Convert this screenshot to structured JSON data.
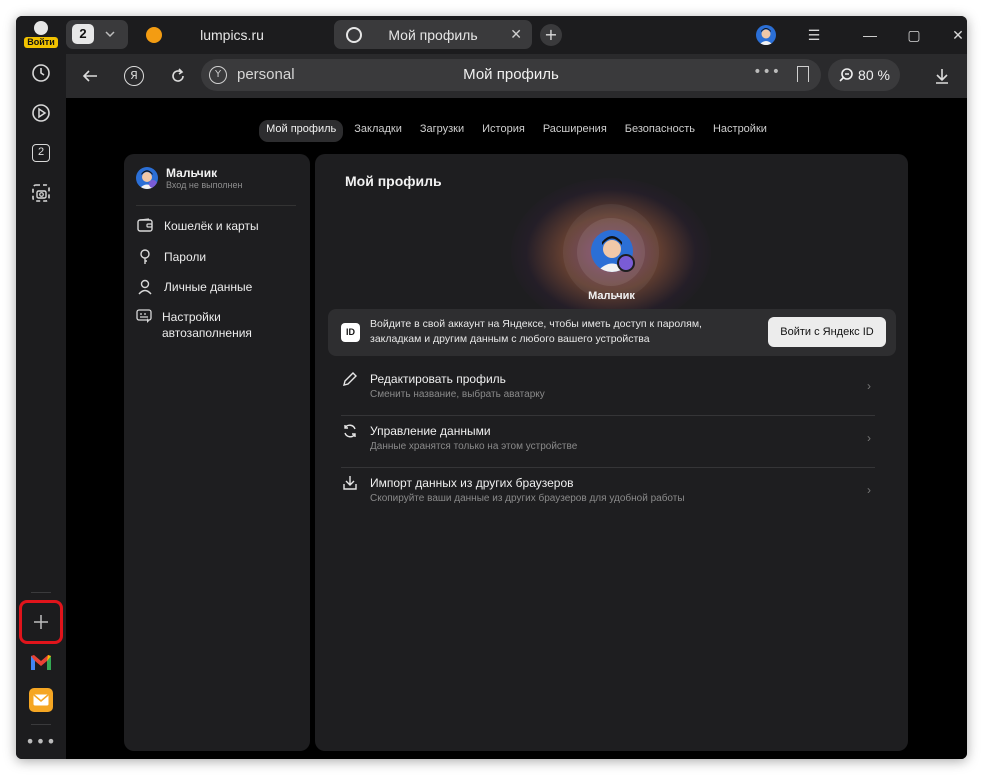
{
  "rail": {
    "signin_label": "Войти",
    "tab_count": "2"
  },
  "tabs": {
    "count": "2",
    "items": [
      {
        "title": "lumpics.ru",
        "active": false
      },
      {
        "title": "Мой профиль",
        "active": true
      }
    ]
  },
  "address": {
    "host": "personal",
    "page_title": "Мой профиль",
    "zoom": "80 %"
  },
  "settings_nav": [
    "Мой профиль",
    "Закладки",
    "Загрузки",
    "История",
    "Расширения",
    "Безопасность",
    "Настройки"
  ],
  "sidebar": {
    "user_name": "Мальчик",
    "user_status": "Вход не выполнен",
    "items": [
      {
        "label": "Кошелёк и карты",
        "icon": "wallet-icon"
      },
      {
        "label": "Пароли",
        "icon": "key-icon"
      },
      {
        "label": "Личные данные",
        "icon": "person-icon"
      },
      {
        "label": "Настройки автозаполнения",
        "icon": "autofill-icon"
      }
    ]
  },
  "main": {
    "title": "Мой профиль",
    "profile_name": "Мальчик",
    "id_icon": "ID",
    "id_banner_text": "Войдите в свой аккаунт на Яндексе, чтобы иметь доступ к паролям, закладкам и другим данным с любого вашего устройства",
    "id_button": "Войти с Яндекс ID",
    "rows": [
      {
        "title": "Редактировать профиль",
        "subtitle": "Сменить название, выбрать аватарку",
        "icon": "pencil-icon"
      },
      {
        "title": "Управление данными",
        "subtitle": "Данные хранятся только на этом устройстве",
        "icon": "sync-icon"
      },
      {
        "title": "Импорт данных из других браузеров",
        "subtitle": "Скопируйте ваши данные из других браузеров для удобной работы",
        "icon": "import-icon"
      }
    ]
  },
  "colors": {
    "accent_highlight": "#e0141b",
    "signin_badge": "#f2c200",
    "window_bg": "#1a1a1c"
  }
}
